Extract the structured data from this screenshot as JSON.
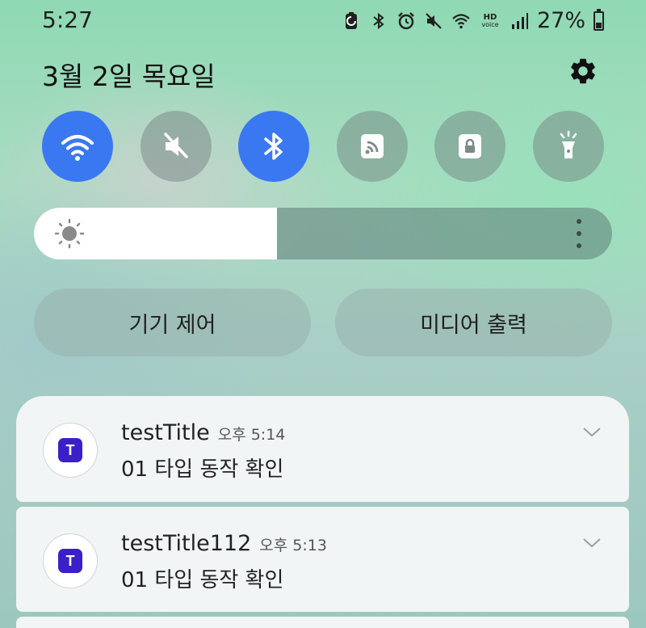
{
  "status_bar": {
    "time": "5:27",
    "hd_label": "HD",
    "hd_sub": "voice",
    "battery_percent": "27%",
    "icons": [
      "battery-saver-icon",
      "bluetooth-icon",
      "alarm-icon",
      "mute-icon",
      "wifi-icon",
      "hd-voice-icon",
      "signal-icon",
      "battery-icon"
    ]
  },
  "header": {
    "date": "3월 2일 목요일",
    "settings_icon": "gear-icon"
  },
  "quick_toggles": [
    {
      "icon": "wifi-icon",
      "on": true
    },
    {
      "icon": "mute-icon",
      "on": false
    },
    {
      "icon": "bluetooth-icon",
      "on": true
    },
    {
      "icon": "nfc-icon",
      "on": false
    },
    {
      "icon": "lock-rotation-icon",
      "on": false
    },
    {
      "icon": "flashlight-icon",
      "on": false
    }
  ],
  "brightness": {
    "level": 0.42,
    "icon": "sun-icon"
  },
  "buttons": {
    "device_control": "기기 제어",
    "media_output": "미디어 출력"
  },
  "notifications": [
    {
      "app_letter": "T",
      "title": "testTitle",
      "time": "오후 5:14",
      "body": "01 타입 동작 확인"
    },
    {
      "app_letter": "T",
      "title": "testTitle112",
      "time": "오후 5:13",
      "body": "01 타입 동작 확인"
    }
  ],
  "colors": {
    "toggle_on": "#3a78f2",
    "app_icon": "#3b1fc8"
  }
}
